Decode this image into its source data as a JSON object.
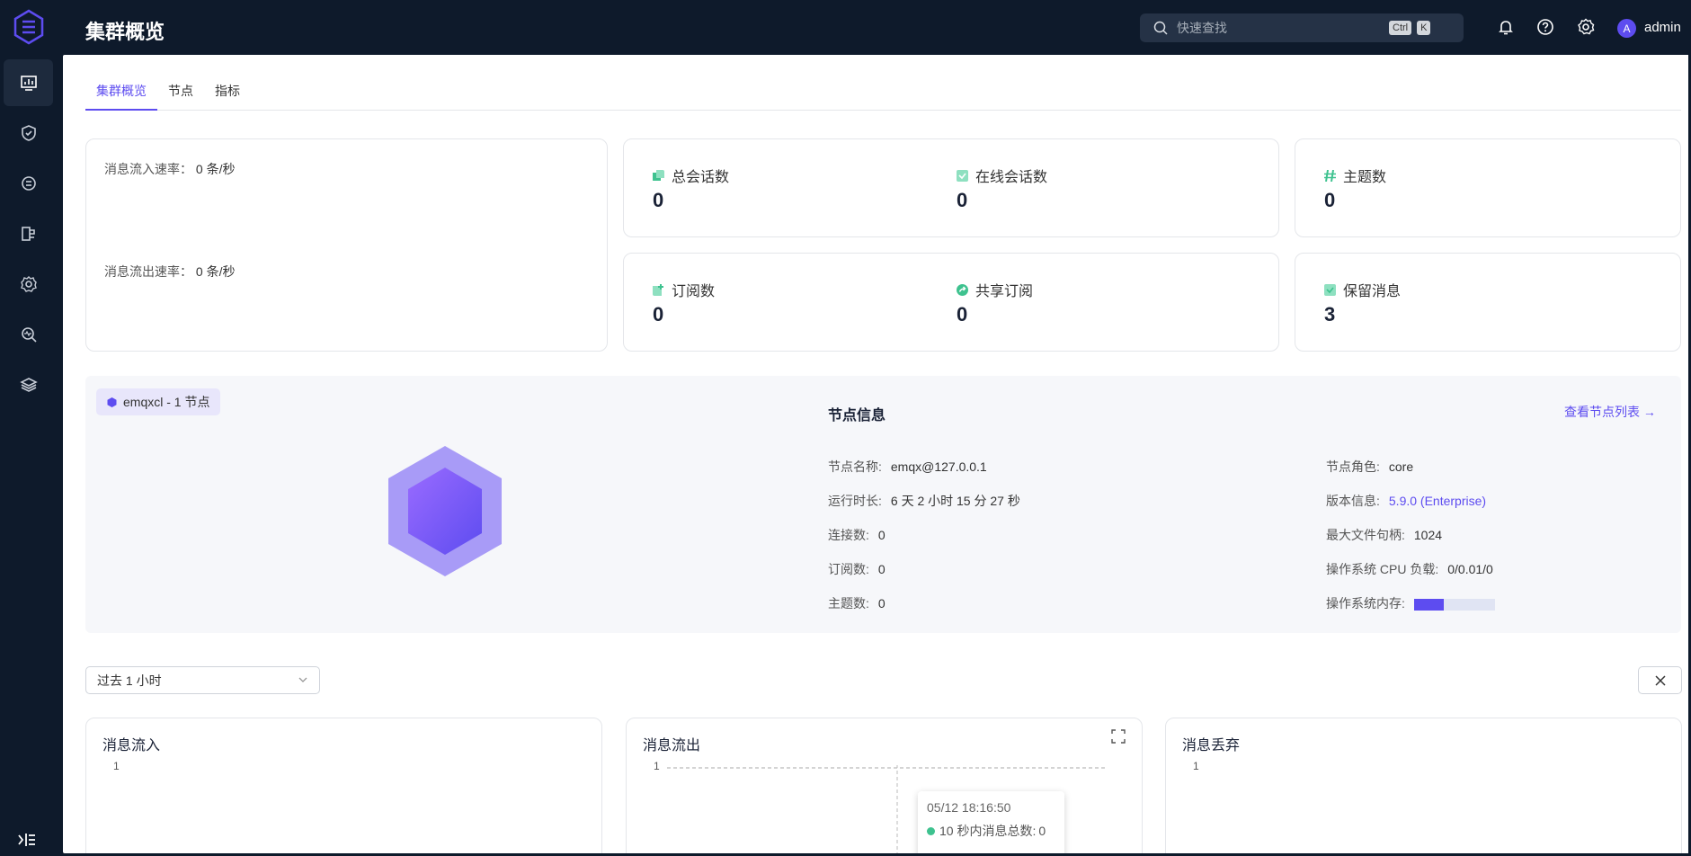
{
  "header": {
    "title": "集群概览",
    "search_placeholder": "快速查找",
    "shortcut_ctrl": "Ctrl",
    "shortcut_k": "K",
    "avatar_letter": "A",
    "username": "admin"
  },
  "sidebar": {
    "items": [
      {
        "icon": "dashboard-icon"
      },
      {
        "icon": "shield-check-icon"
      },
      {
        "icon": "integration-icon"
      },
      {
        "icon": "flow-icon"
      },
      {
        "icon": "settings-gear-icon"
      },
      {
        "icon": "diagnose-icon"
      },
      {
        "icon": "layers-icon"
      }
    ],
    "active_index": 0
  },
  "tabs": [
    "集群概览",
    "节点",
    "指标"
  ],
  "rates": {
    "in_label": "消息流入速率：",
    "in_value": "0 条/秒",
    "out_label": "消息流出速率：",
    "out_value": "0 条/秒"
  },
  "stats": {
    "total_sessions_label": "总会话数",
    "total_sessions": "0",
    "online_sessions_label": "在线会话数",
    "online_sessions": "0",
    "topics_label": "主题数",
    "topics": "0",
    "subscriptions_label": "订阅数",
    "subscriptions": "0",
    "shared_subs_label": "共享订阅",
    "shared_subs": "0",
    "retained_label": "保留消息",
    "retained": "3"
  },
  "node": {
    "cluster_tag": "emqxcl - 1 节点",
    "title": "节点信息",
    "link": "查看节点列表 →",
    "name_label": "节点名称:",
    "name": "emqx@127.0.0.1",
    "uptime_label": "运行时长:",
    "uptime": "6 天 2 小时 15 分 27 秒",
    "connections_label": "连接数:",
    "connections": "0",
    "subs_label": "订阅数:",
    "subs": "0",
    "topics_label": "主题数:",
    "topics": "0",
    "role_label": "节点角色:",
    "role": "core",
    "version_label": "版本信息:",
    "version": "5.9.0 (Enterprise)",
    "max_fds_label": "最大文件句柄:",
    "max_fds": "1024",
    "cpu_label": "操作系统 CPU 负载:",
    "cpu": "0/0.01/0",
    "mem_label": "操作系统内存:",
    "mem_fraction": 0.37
  },
  "filter": {
    "range": "过去 1 小时"
  },
  "charts": {
    "in_title": "消息流入",
    "in_tick": "1",
    "out_title": "消息流出",
    "out_tick": "1",
    "drop_title": "消息丢弃",
    "drop_tick": "1",
    "tooltip_time": "05/12 18:16:50",
    "tooltip_series": "10 秒内消息总数:",
    "tooltip_value": "0"
  },
  "colors": {
    "accent": "#5d4cf0",
    "teal": "#3ec28f",
    "sidebar_bg": "#0e1a2b"
  }
}
